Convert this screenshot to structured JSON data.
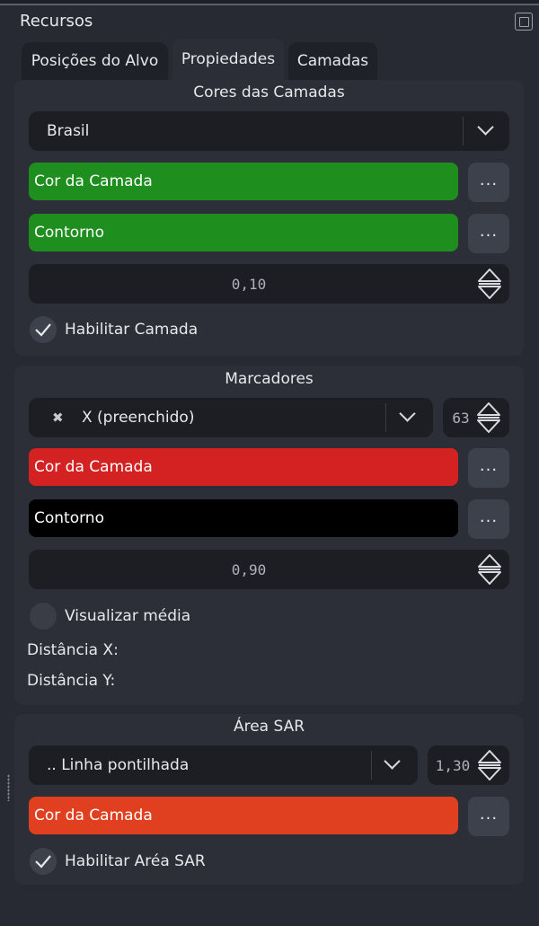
{
  "dock": {
    "title": "Recursos"
  },
  "tabs": [
    {
      "label": "Posições do Alvo"
    },
    {
      "label": "Propiedades"
    },
    {
      "label": "Camadas"
    }
  ],
  "layer_colors": {
    "title": "Cores das Camadas",
    "country_select": "Brasil",
    "fill_label": "Cor da Camada",
    "fill_color": "#1e8e1e",
    "outline_label": "Contorno",
    "outline_color": "#1e8e1e",
    "opacity": "0,10",
    "enable_label": "Habilitar Camada",
    "enable_checked": true
  },
  "markers": {
    "title": "Marcadores",
    "marker_glyph": "✖",
    "marker_select": "X (preenchido)",
    "size": "63",
    "fill_label": "Cor da Camada",
    "fill_color": "#d42222",
    "outline_label": "Contorno",
    "outline_color": "#000000",
    "opacity": "0,90",
    "show_mean_label": "Visualizar média",
    "show_mean_checked": false,
    "distance_x_label": "Distância X:",
    "distance_y_label": "Distância Y:"
  },
  "sar_area": {
    "title": "Área SAR",
    "line_select": ".. Linha pontilhada",
    "line_width": "1,30",
    "fill_label": "Cor da Camada",
    "fill_color": "#e04020",
    "enable_label": "Habilitar Aréa SAR",
    "enable_checked": true
  },
  "common": {
    "more_button": "..."
  },
  "icons": {
    "float": "float-window-icon",
    "dropdown": "chevron-down-icon",
    "spin": "spin-arrows-icon",
    "check": "checkmark-icon",
    "grip": "drag-grip-icon"
  }
}
